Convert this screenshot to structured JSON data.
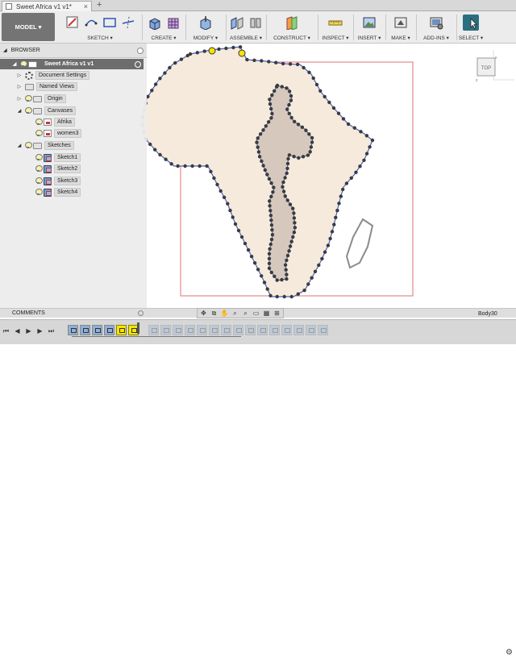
{
  "app": {
    "document_title": "Sweet Africa v1 v1*",
    "close_glyph": "×",
    "new_tab_glyph": "+"
  },
  "toolbar": {
    "workspace_label": "MODEL ▾",
    "groups": [
      {
        "label": "SKETCH ▾"
      },
      {
        "label": "CREATE ▾"
      },
      {
        "label": "MODIFY ▾"
      },
      {
        "label": "ASSEMBLE ▾"
      },
      {
        "label": "CONSTRUCT ▾"
      },
      {
        "label": "INSPECT ▾"
      },
      {
        "label": "INSERT ▾"
      },
      {
        "label": "MAKE ▾"
      },
      {
        "label": "ADD-INS ▾"
      },
      {
        "label": "SELECT ▾"
      }
    ]
  },
  "viewcube": {
    "label": "TOP",
    "axis_x": "x",
    "axis_z": "z"
  },
  "browser": {
    "title": "BROWSER",
    "root": "Sweet Africa v1 v1",
    "items": [
      {
        "label": "Document Settings"
      },
      {
        "label": "Named Views"
      },
      {
        "label": "Origin"
      },
      {
        "label": "Canvases"
      },
      {
        "label": "Afrika"
      },
      {
        "label": "women3"
      },
      {
        "label": "Sketches"
      },
      {
        "label": "Sketch1"
      },
      {
        "label": "Sketch2"
      },
      {
        "label": "Sketch3"
      },
      {
        "label": "Sketch4"
      }
    ]
  },
  "comments": {
    "title": "COMMENTS"
  },
  "status": {
    "selection_name": "Body30"
  },
  "colors": {
    "africa_fill": "#f6eadc",
    "figure_fill": "#d6c8bd",
    "sketch_line": "#3f63c8",
    "canvas_border": "#e07070",
    "select_accent": "#2a6f80",
    "timeline_selected": "#f5e600"
  }
}
